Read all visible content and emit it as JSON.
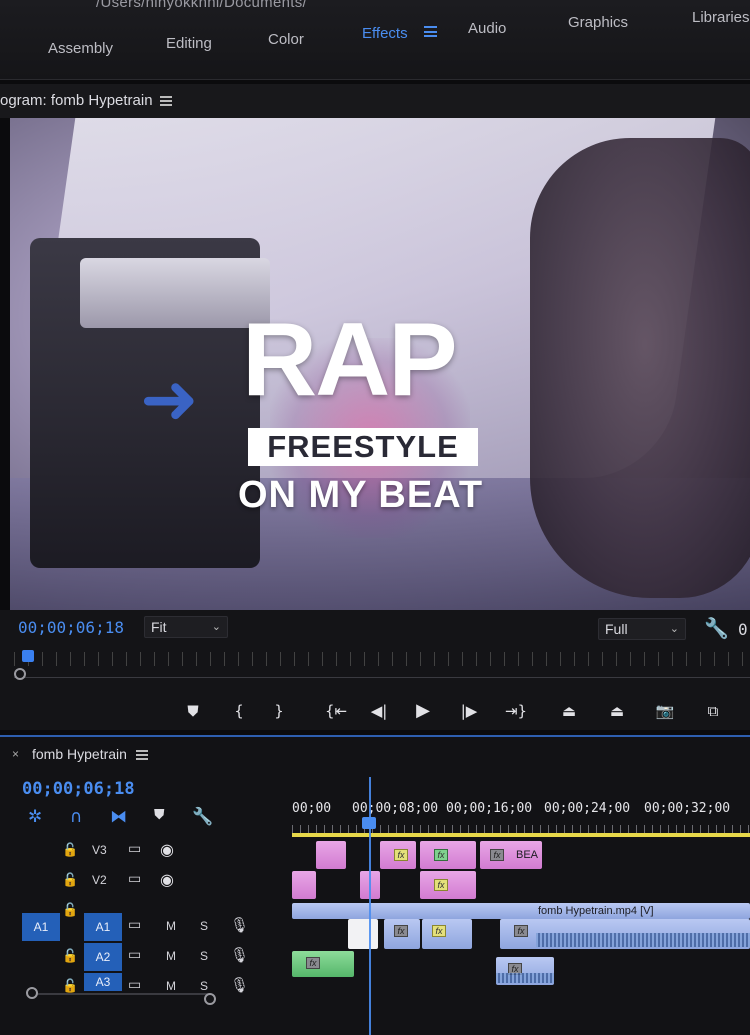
{
  "path": "/Users/ninyokkhhi/Documents/",
  "workspaces": [
    {
      "label": "Assembly"
    },
    {
      "label": "Editing"
    },
    {
      "label": "Color"
    },
    {
      "label": "Effects"
    },
    {
      "label": "Audio"
    },
    {
      "label": "Graphics"
    },
    {
      "label": "Libraries"
    }
  ],
  "program": {
    "title": "ogram: fomb Hypetrain",
    "overlay_title": {
      "line1": "RAP",
      "line2": "FREESTYLE",
      "line3": "ON MY BEAT"
    },
    "timecode": "00;00;06;18",
    "zoom": "Fit",
    "resolution": "Full",
    "trailing": "0"
  },
  "transport": {
    "add_marker": "⛊",
    "mark_in": "{",
    "mark_out": "}",
    "go_to_in": "{⇤",
    "step_back": "◀|",
    "play": "▶",
    "step_forward": "|▶",
    "go_to_out": "⇥}",
    "lift": "⏏",
    "extract": "⏏",
    "export_frame": "📷",
    "comparison": "⧉"
  },
  "timeline": {
    "close": "×",
    "sequence_name": "fomb Hypetrain",
    "timecode": "00;00;06;18",
    "ruler": [
      "00;00",
      "00;00;08;00",
      "00;00;16;00",
      "00;00;24;00",
      "00;00;32;00"
    ],
    "tracks": {
      "v3": "V3",
      "v2": "V2",
      "a1_source": "A1",
      "a1": "A1",
      "a2": "A2",
      "a3": "A3",
      "mute": "M",
      "solo": "S"
    },
    "clips": {
      "bea": "BEA",
      "fomb_video": "fomb Hypetrain.mp4 [V]",
      "fx": "fx"
    }
  },
  "colors": {
    "accent": "#4a8df0",
    "video_clip": "#d27bd1",
    "audio_clip": "#8ea5de",
    "work_area": "#e7d84a"
  }
}
